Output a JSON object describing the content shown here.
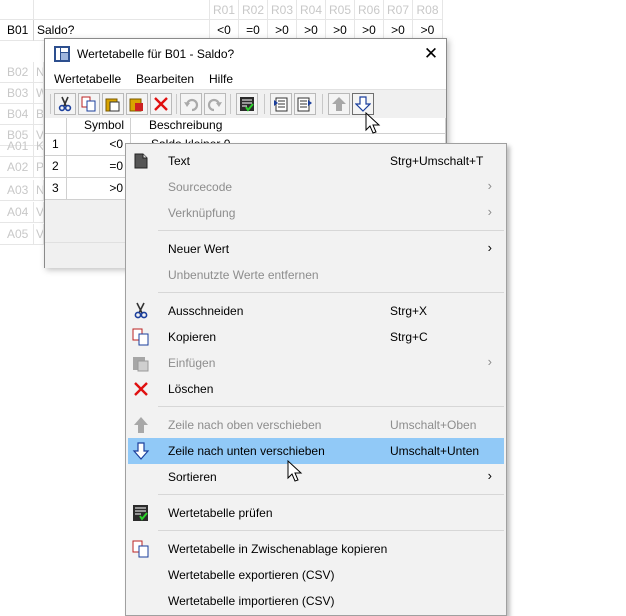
{
  "grid": {
    "columns": [
      "R01",
      "R02",
      "R03",
      "R04",
      "R05",
      "R06",
      "R07",
      "R08"
    ],
    "current_row": {
      "id": "B01",
      "text": "Saldo?",
      "cells": [
        "<0",
        "=0",
        ">0",
        ">0",
        ">0",
        ">0",
        ">0",
        ">0"
      ]
    },
    "rows": [
      {
        "id": "B02",
        "prefix": "N"
      },
      {
        "id": "B03",
        "prefix": "W"
      },
      {
        "id": "B04",
        "prefix": "B"
      },
      {
        "id": "B05",
        "prefix": "V"
      },
      {
        "id": "A01",
        "prefix": "K"
      },
      {
        "id": "A02",
        "prefix": "P"
      },
      {
        "id": "A03",
        "prefix": "N"
      },
      {
        "id": "A04",
        "prefix": "V"
      },
      {
        "id": "A05",
        "prefix": "V"
      }
    ]
  },
  "dialog": {
    "title": "Wertetabelle für B01 - Saldo?",
    "close_glyph": "✕",
    "menu": [
      "Wertetabelle",
      "Bearbeiten",
      "Hilfe"
    ],
    "table": {
      "headers": [
        "Symbol",
        "Beschreibung"
      ],
      "rows": [
        {
          "num": "1",
          "symbol": "<0",
          "desc": "Saldo kleiner 0"
        },
        {
          "num": "2",
          "symbol": "=0",
          "desc": ""
        },
        {
          "num": "3",
          "symbol": ">0",
          "desc": ""
        }
      ]
    }
  },
  "context_menu": {
    "items": {
      "text": {
        "label": "Text",
        "shortcut": "Strg+Umschalt+T"
      },
      "sourcecode": {
        "label": "Sourcecode"
      },
      "verknuepfung": {
        "label": "Verknüpfung"
      },
      "neuer_wert": {
        "label": "Neuer Wert"
      },
      "unbenutzte": {
        "label": "Unbenutzte Werte entfernen"
      },
      "ausschneiden": {
        "label": "Ausschneiden",
        "shortcut": "Strg+X"
      },
      "kopieren": {
        "label": "Kopieren",
        "shortcut": "Strg+C"
      },
      "einfuegen": {
        "label": "Einfügen"
      },
      "loeschen": {
        "label": "Löschen"
      },
      "nach_oben": {
        "label": "Zeile nach oben verschieben",
        "shortcut": "Umschalt+Oben"
      },
      "nach_unten": {
        "label": "Zeile nach unten verschieben",
        "shortcut": "Umschalt+Unten"
      },
      "sortieren": {
        "label": "Sortieren"
      },
      "pruefen": {
        "label": "Wertetabelle prüfen"
      },
      "zwischenablage": {
        "label": "Wertetabelle in Zwischenablage kopieren"
      },
      "exportieren": {
        "label": "Wertetabelle exportieren (CSV)"
      },
      "importieren": {
        "label": "Wertetabelle importieren (CSV)"
      }
    },
    "submenu_arrow": "›",
    "highlight_color": "#91c9f7"
  }
}
